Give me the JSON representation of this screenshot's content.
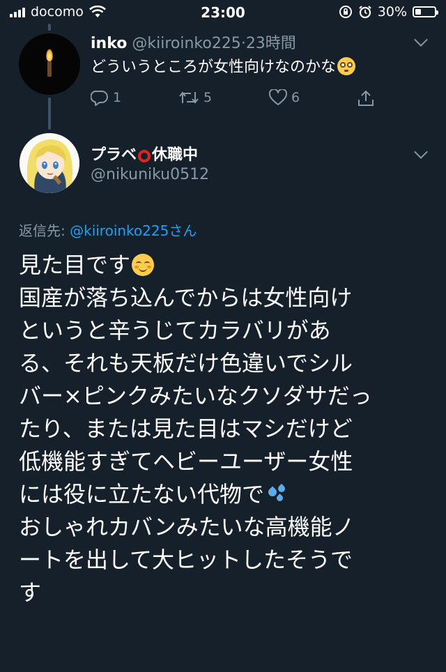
{
  "status_bar": {
    "carrier": "docomo",
    "time": "23:00",
    "battery_percent": "30%",
    "battery_level": 0.3
  },
  "tweet_parent": {
    "name": "inko",
    "handle": "@kiiroinko225",
    "separator": "·",
    "time": "23時間",
    "text": "どういうところが女性向けなのかな",
    "text_emoji": "flushed-face-emoji",
    "counts": {
      "reply": "1",
      "retweet": "5",
      "like": "6"
    }
  },
  "tweet_main": {
    "name_part1": "プラベ",
    "name_part2": "休職中",
    "handle": "@nikuniku0512",
    "reply_prefix": "返信先: ",
    "reply_mention": "@kiiroinko225",
    "reply_suffix": "さん",
    "lines": [
      "見た目です",
      "国産が落ち込んでからは女性向け",
      "というと辛うじてカラバリがあ",
      "る、それも天板だけ色違いでシル",
      "バー×ピンクみたいなクソダサだっ",
      "たり、または見た目はマシだけど",
      "低機能すぎてヘビーユーザー女性",
      "には役に立たない代物で",
      "おしゃれカバンみたいな高機能ノ",
      "ートを出して大ヒットしたそうで",
      "す"
    ]
  },
  "colors": {
    "background": "#15202b",
    "secondary_text": "#8899a6",
    "link": "#1da1f2",
    "thread_line": "#3d5466"
  }
}
